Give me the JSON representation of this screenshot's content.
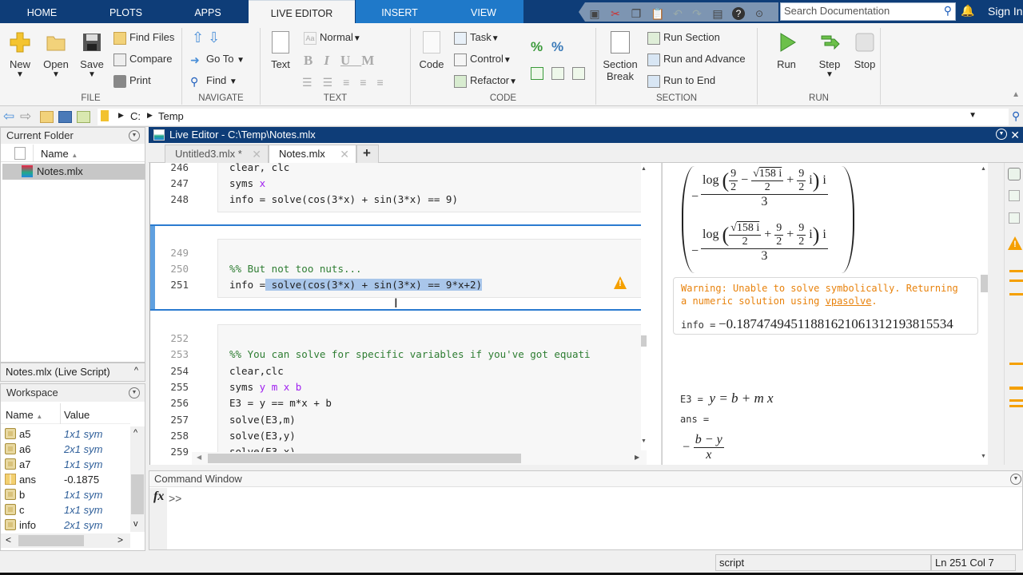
{
  "ribbon_tabs": [
    "HOME",
    "PLOTS",
    "APPS",
    "LIVE EDITOR",
    "INSERT",
    "VIEW"
  ],
  "active_tab": "LIVE EDITOR",
  "search": {
    "placeholder": "Search Documentation"
  },
  "sign_in": "Sign In",
  "file_group": {
    "label": "FILE",
    "new": "New",
    "open": "Open",
    "save": "Save",
    "find_files": "Find Files",
    "compare": "Compare",
    "print": "Print"
  },
  "navigate_group": {
    "label": "NAVIGATE",
    "go_to": "Go To",
    "find": "Find"
  },
  "text_group": {
    "label": "TEXT",
    "text": "Text",
    "style": "Normal",
    "bold": "B",
    "italic": "I",
    "underline": "U",
    "mono": "M"
  },
  "code_group": {
    "label": "CODE",
    "code": "Code",
    "task": "Task",
    "control": "Control",
    "refactor": "Refactor"
  },
  "section_group": {
    "label": "SECTION",
    "section_break_1": "Section",
    "section_break_2": "Break",
    "run_section": "Run Section",
    "run_and_advance": "Run and Advance",
    "run_to_end": "Run to End"
  },
  "run_group": {
    "label": "RUN",
    "run": "Run",
    "step": "Step",
    "stop": "Stop"
  },
  "address": {
    "path": [
      "C:",
      "Temp"
    ]
  },
  "current_folder": {
    "title": "Current Folder",
    "col_name": "Name",
    "files": [
      "Notes.mlx"
    ]
  },
  "details": {
    "title": "Notes.mlx  (Live Script)"
  },
  "workspace": {
    "title": "Workspace",
    "col_name": "Name",
    "col_value": "Value",
    "rows": [
      {
        "name": "a5",
        "value": "1x1 sym",
        "type": "sym"
      },
      {
        "name": "a6",
        "value": "2x1 sym",
        "type": "sym"
      },
      {
        "name": "a7",
        "value": "1x1 sym",
        "type": "sym"
      },
      {
        "name": "ans",
        "value": "-0.1875",
        "type": "double"
      },
      {
        "name": "b",
        "value": "1x1 sym",
        "type": "sym"
      },
      {
        "name": "c",
        "value": "1x1 sym",
        "type": "sym"
      },
      {
        "name": "info",
        "value": "2x1 sym",
        "type": "sym"
      }
    ]
  },
  "editor": {
    "title": "Live Editor - C:\\Temp\\Notes.mlx",
    "tabs": [
      {
        "label": "Untitled3.mlx *"
      },
      {
        "label": "Notes.mlx"
      }
    ],
    "active_tab": "Notes.mlx",
    "lines": [
      {
        "n": "246",
        "text": "clear, clc"
      },
      {
        "n": "247",
        "text": "syms ",
        "var": "x"
      },
      {
        "n": "248",
        "text": "info = solve(cos(3*x) + sin(3*x) == 9)"
      },
      {
        "n": "249",
        "text": ""
      },
      {
        "n": "250",
        "text": "%% But not too nuts..."
      },
      {
        "n": "251",
        "pre": "info =",
        "sel": " solve(cos(3*x) + sin(3*x) == 9*x+2)"
      },
      {
        "n": "252",
        "text": ""
      },
      {
        "n": "253",
        "text": "%% You can solve for specific variables if you've got equati"
      },
      {
        "n": "254",
        "text": "clear,clc"
      },
      {
        "n": "255",
        "text": "syms ",
        "var": "y m x b"
      },
      {
        "n": "256",
        "text": "E3 = y == m*x + b"
      },
      {
        "n": "257",
        "text": "solve(E3,m)"
      },
      {
        "n": "258",
        "text": "solve(E3,y)"
      },
      {
        "n": "259",
        "text": "solve(E3,x)"
      }
    ]
  },
  "output": {
    "matrix_row1": {
      "num_pre": "log",
      "a": "9",
      "b": "2",
      "sqrt": "158 i",
      "sqrtden": "2",
      "c": "9",
      "d": "2",
      "tail": "i",
      "den": "3"
    },
    "matrix_row2": {
      "num_pre": "log",
      "sqrt": "158 i",
      "sqrtden": "2",
      "a": "9",
      "b": "2",
      "c": "9",
      "d": "2",
      "tail": "i",
      "den": "3"
    },
    "warning_1": "Warning: Unable to solve symbolically. Returning",
    "warning_2a": "a numeric solution using ",
    "warning_link": "vpasolve",
    "warning_2b": ".",
    "info_label": "info =",
    "info_value": "−0.18747494511881621061312193815534",
    "e3_label": "E3 =",
    "e3_value": "y = b + m x",
    "ans_label": "ans =",
    "ans_num": "b − y",
    "ans_den": "x"
  },
  "command_window": {
    "title": "Command Window",
    "prompt": ">>"
  },
  "status": {
    "mode": "script",
    "position": "Ln  251 Col  7"
  },
  "colors": {
    "title_bar": "#0e3d78",
    "tab_blue": "#1f79c9",
    "comment": "#2e7d32",
    "sym_var": "#a020f0",
    "warning": "#e8820c",
    "selection": "#a9c6ea"
  }
}
